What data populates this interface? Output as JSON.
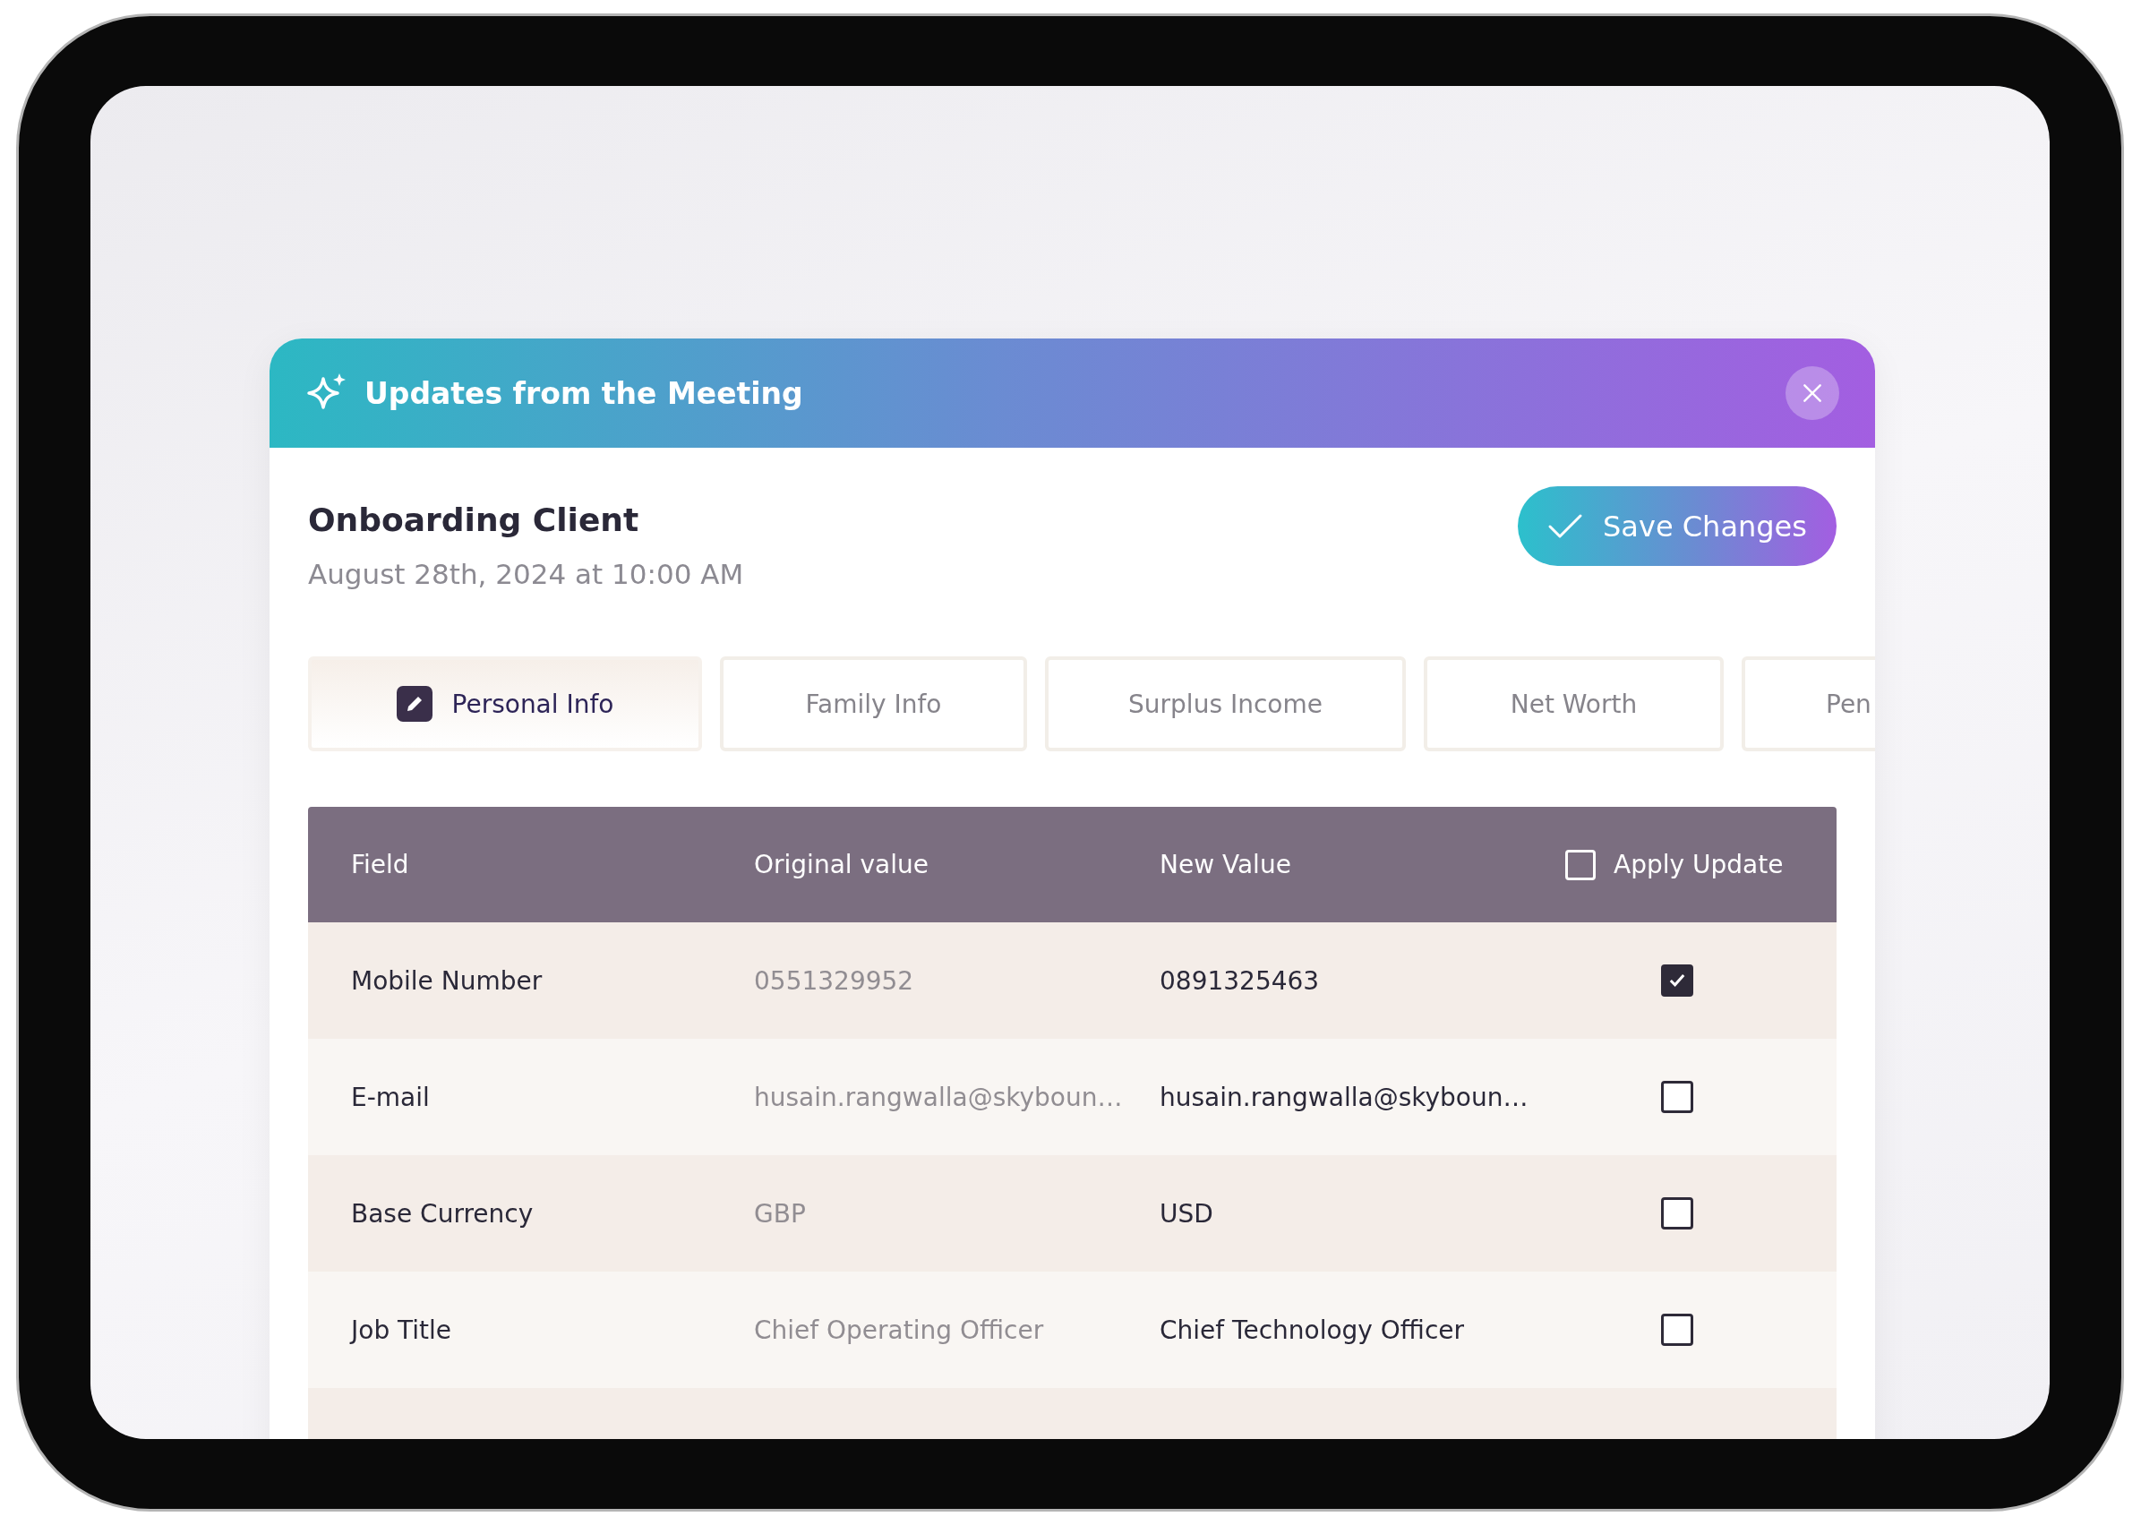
{
  "header": {
    "title": "Updates from the Meeting"
  },
  "client": {
    "name": "Onboarding Client",
    "date": "August 28th, 2024 at 10:00 AM"
  },
  "save_button": {
    "label": "Save Changes"
  },
  "tabs": [
    {
      "label": "Personal Info",
      "selected": true
    },
    {
      "label": "Family Info",
      "selected": false
    },
    {
      "label": "Surplus Income",
      "selected": false
    },
    {
      "label": "Net Worth",
      "selected": false
    },
    {
      "label": "Pen",
      "selected": false
    }
  ],
  "table": {
    "columns": [
      "Field",
      "Original value",
      "New Value",
      "Apply Update"
    ],
    "apply_all_checked": false,
    "rows": [
      {
        "field": "Mobile Number",
        "original": "0551329952",
        "new": "0891325463",
        "checked": true
      },
      {
        "field": "E-mail",
        "original": "husain.rangwalla@skyboun…",
        "new": "husain.rangwalla@skyboun…",
        "checked": false
      },
      {
        "field": "Base Currency",
        "original": "GBP",
        "new": "USD",
        "checked": false
      },
      {
        "field": "Job Title",
        "original": "Chief Operating Officer",
        "new": "Chief Technology Officer",
        "checked": false
      }
    ]
  }
}
